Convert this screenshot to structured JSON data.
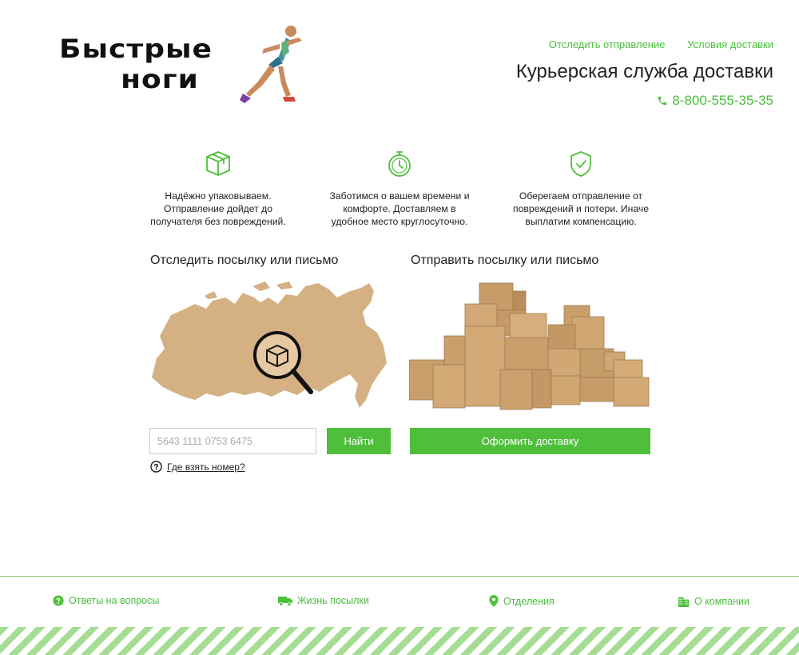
{
  "brand": {
    "line1": "Быстрые",
    "line2": "ноги"
  },
  "header": {
    "links": [
      "Отследить отправление",
      "Условия доставки"
    ],
    "tagline": "Курьерская служба доставки",
    "phone": "8-800-555-35-35"
  },
  "features": [
    {
      "icon": "package-icon",
      "text": "Надёжно упаковываем. Отправление дойдет до получателя без повреждений."
    },
    {
      "icon": "stopwatch-icon",
      "text": "Заботимся о вашем времени и комфорте. Доставляем в удобное место круглосуточно."
    },
    {
      "icon": "shield-check-icon",
      "text": "Оберегаем отправление от повреждений и потери. Иначе выплатим компенсацию."
    }
  ],
  "track": {
    "title": "Отследить посылку или письмо",
    "placeholder": "5643 1111 0753 6475",
    "button": "Найти",
    "help": "Где взять номер?"
  },
  "send": {
    "title": "Отправить посылку или письмо",
    "button": "Оформить доставку"
  },
  "footer": {
    "links": [
      {
        "icon": "question-icon",
        "label": "Ответы на вопросы"
      },
      {
        "icon": "truck-icon",
        "label": "Жизнь посылки"
      },
      {
        "icon": "map-pin-icon",
        "label": "Отделения"
      },
      {
        "icon": "building-icon",
        "label": "О компании"
      }
    ]
  },
  "colors": {
    "accent": "#4fbf3b",
    "map": "#d4b083",
    "box": "#c9a06e"
  }
}
